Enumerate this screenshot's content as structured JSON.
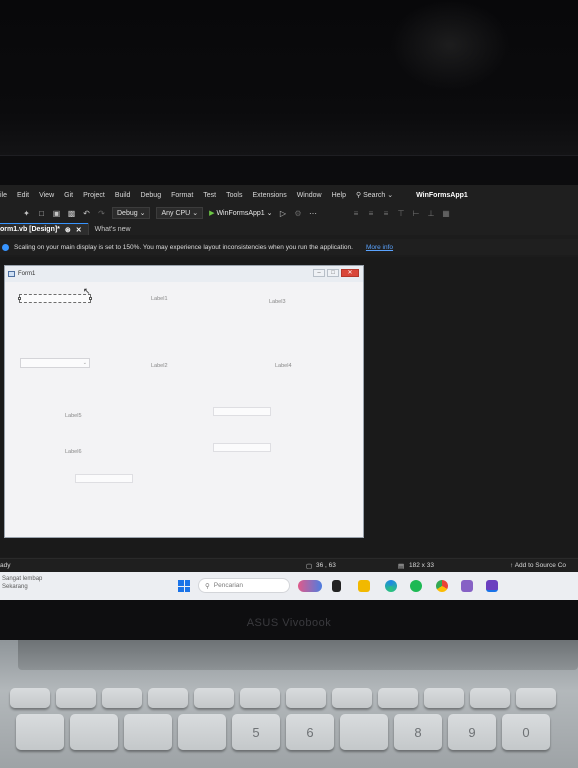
{
  "menubar": {
    "items": [
      "ile",
      "Edit",
      "View",
      "Git",
      "Project",
      "Build",
      "Debug",
      "Format",
      "Test",
      "Tools",
      "Extensions",
      "Window",
      "Help"
    ],
    "search_label": "Search",
    "solution_name": "WinFormsApp1"
  },
  "toolbar": {
    "configuration": "Debug",
    "platform": "Any CPU",
    "run_target": "WinFormsApp1"
  },
  "tabs": {
    "active": "orm1.vb [Design]*",
    "inactive": "What's new"
  },
  "infobar": {
    "message": "Scaling on your main display is set to 150%. You may experience layout inconsistencies when you run the application.",
    "link": "More info"
  },
  "form": {
    "title": "Form1",
    "labels": [
      "Label1",
      "Label2",
      "Label3",
      "Label4",
      "Label5",
      "Label6"
    ]
  },
  "statusbar": {
    "ready": "ady",
    "position": "36 , 63",
    "size": "182 x 33",
    "source_control": "Add to Source Co"
  },
  "taskbar": {
    "weather_line1": "Sangat lembap",
    "weather_line2": "Sekarang",
    "search_placeholder": "Pencarian"
  },
  "laptop": {
    "brand": "ASUS Vivobook",
    "key_glyphs": [
      "5",
      "6",
      "8",
      "9",
      "0"
    ]
  },
  "colors": {
    "vs_background": "#1f1f1f",
    "accent": "#3794ff",
    "close_button": "#d9473a"
  }
}
